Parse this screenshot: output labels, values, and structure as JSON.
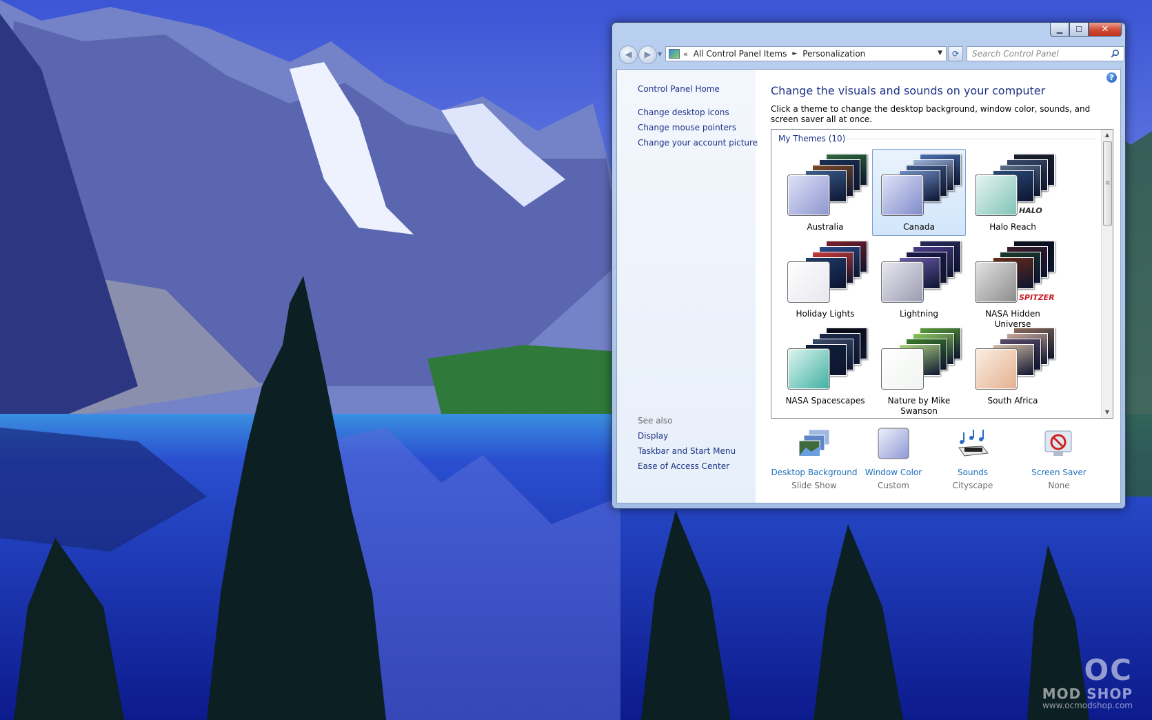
{
  "window": {
    "caption_buttons": {
      "minimize": "▁",
      "maximize": "☐",
      "close": "✕"
    },
    "address": {
      "overflow": "«",
      "segments": [
        "All Control Panel Items",
        "Personalization"
      ],
      "separator": "►",
      "dropdown": "▼"
    },
    "search": {
      "placeholder": "Search Control Panel"
    },
    "nav": {
      "back": "◀",
      "forward": "▶",
      "history": "▼",
      "refresh": "⟳"
    }
  },
  "sidebar": {
    "home": "Control Panel Home",
    "links": [
      "Change desktop icons",
      "Change mouse pointers",
      "Change your account picture"
    ],
    "see_also": {
      "heading": "See also",
      "links": [
        "Display",
        "Taskbar and Start Menu",
        "Ease of Access Center"
      ]
    }
  },
  "main": {
    "help": "?",
    "title": "Change the visuals and sounds on your computer",
    "description": "Click a theme to change the desktop background, window color, sounds, and screen saver all at once.",
    "group_label": "My Themes (10)",
    "scroll": {
      "up": "▲",
      "down": "▼",
      "grip": "≡"
    },
    "themes": [
      {
        "name": "Australia",
        "selected": false,
        "swatch": [
          "#dfe3f7",
          "#8d95cf"
        ],
        "cards": [
          "#2d6a3a",
          "#1b2f52",
          "#7a4a2a",
          "#3a5f8f"
        ]
      },
      {
        "name": "Canada",
        "selected": true,
        "swatch": [
          "#dfe4f6",
          "#7f8acb"
        ],
        "cards": [
          "#4a6fb0",
          "#9bb4d8",
          "#3d5a8a",
          "#6f8fc8"
        ]
      },
      {
        "name": "Halo Reach",
        "selected": false,
        "swatch": [
          "#e7f5f1",
          "#7fc3b8"
        ],
        "cards": [
          "#1a1f2a",
          "#3b4a6a",
          "#5a6f8a",
          "#2a4a7a"
        ],
        "brand": "HALO",
        "brand_color": "#2a2a2a"
      },
      {
        "name": "Holiday Lights",
        "selected": false,
        "swatch": [
          "#ffffff",
          "#e6e6ee"
        ],
        "cards": [
          "#7a1f2a",
          "#2a4a8a",
          "#c83a3a",
          "#1f3a6a"
        ]
      },
      {
        "name": "Lightning",
        "selected": false,
        "swatch": [
          "#e8e8f0",
          "#9a9ab0"
        ],
        "cards": [
          "#2a2a5a",
          "#4a3a8a",
          "#1a1a4a",
          "#6a5aa8"
        ]
      },
      {
        "name": "NASA Hidden Universe",
        "selected": false,
        "swatch": [
          "#e4e4e4",
          "#8a8a8a"
        ],
        "cards": [
          "#0a0f1a",
          "#3a1a2a",
          "#1a3a2a",
          "#6a2a1a"
        ],
        "brand": "SPITZER",
        "brand_color": "#c81d25"
      },
      {
        "name": "NASA Spacescapes",
        "selected": false,
        "swatch": [
          "#dff5f1",
          "#3fb0a0"
        ],
        "cards": [
          "#0a0a14",
          "#1a2a4a",
          "#3a4a6a",
          "#0f1f3a"
        ]
      },
      {
        "name": "Nature by Mike Swanson",
        "selected": false,
        "swatch": [
          "#ffffff",
          "#f0f4f0"
        ],
        "cards": [
          "#5a9a3a",
          "#8ac85a",
          "#3a7a2a",
          "#b0d880"
        ]
      },
      {
        "name": "South Africa",
        "selected": false,
        "swatch": [
          "#fbeee4",
          "#e3b08e"
        ],
        "cards": [
          "#8a6a5a",
          "#c8a89a",
          "#5a4a6a",
          "#d8c0a8"
        ]
      }
    ],
    "customize": [
      {
        "label": "Desktop Background",
        "value": "Slide Show",
        "icon": "desktop-background-icon"
      },
      {
        "label": "Window Color",
        "value": "Custom",
        "icon": "window-color-icon"
      },
      {
        "label": "Sounds",
        "value": "Cityscape",
        "icon": "sounds-icon"
      },
      {
        "label": "Screen Saver",
        "value": "None",
        "icon": "screen-saver-icon"
      }
    ]
  },
  "watermark": {
    "mark": "OC",
    "sub": "MOD SHOP",
    "url": "www.ocmodshop.com"
  }
}
